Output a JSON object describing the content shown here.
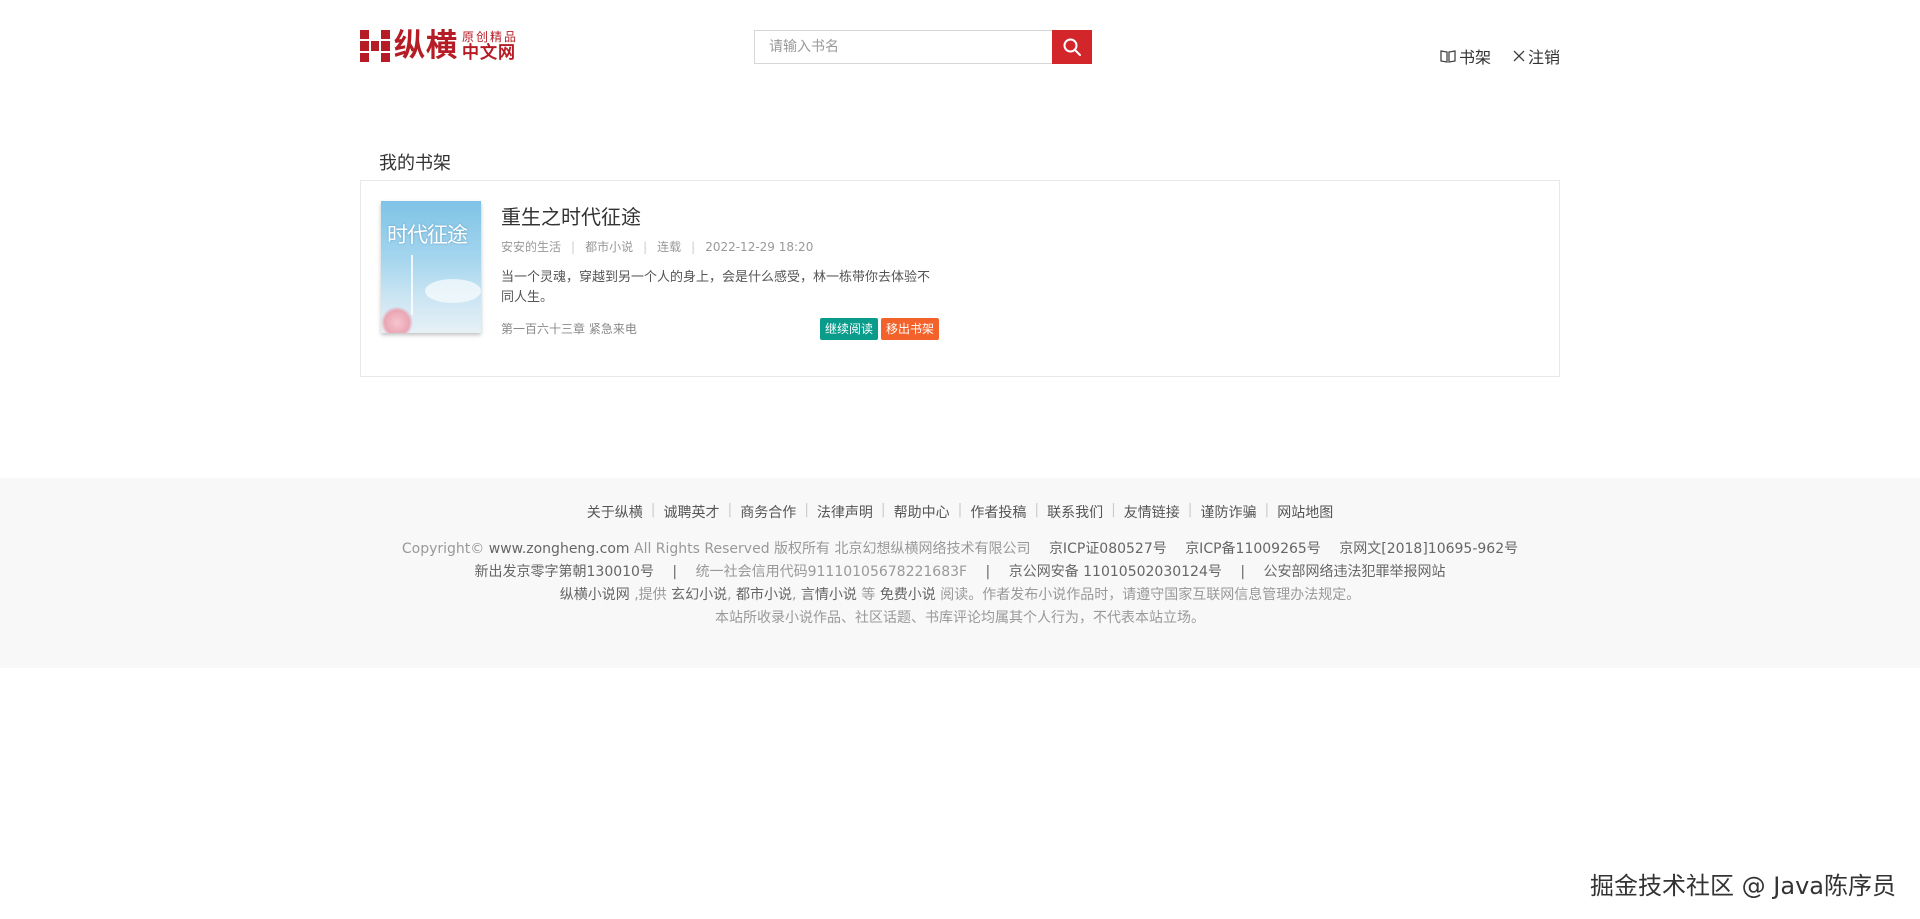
{
  "header": {
    "logo": {
      "main": "纵横",
      "sub_top": "原创精品",
      "sub_bottom": "中文网"
    },
    "search": {
      "placeholder": "请输入书名"
    },
    "links": {
      "bookshelf": "书架",
      "logout": "注销"
    }
  },
  "shelf": {
    "title": "我的书架",
    "book": {
      "cover_text": "时代征途",
      "name": "重生之时代征途",
      "author": "安安的生活",
      "category": "都市小说",
      "status": "连载",
      "updated": "2022-12-29 18:20",
      "description": "当一个灵魂，穿越到另一个人的身上，会是什么感受，林一栋带你去体验不同人生。",
      "latest_chapter": "第一百六十三章 紧急来电",
      "continue_label": "继续阅读",
      "remove_label": "移出书架"
    }
  },
  "footer": {
    "nav": [
      "关于纵横",
      "诚聘英才",
      "商务合作",
      "法律声明",
      "帮助中心",
      "作者投稿",
      "联系我们",
      "友情链接",
      "谨防诈骗",
      "网站地图"
    ],
    "copyright_prefix": "Copyright©",
    "site_domain": "www.zongheng.com",
    "rights": "All Rights Reserved 版权所有 北京幻想纵横网络技术有限公司",
    "icp1": "京ICP证080527号",
    "icp2": "京ICP备11009265号",
    "icp3": "京网文[2018]10695-962号",
    "publish": "新出发京零字第朝130010号",
    "credit_code": "统一社会信用代码91110105678221683F",
    "police": "京公网安备 11010502030124号",
    "report": "公安部网络违法犯罪举报网站",
    "line3_site": "纵横小说网",
    "line3_provide": ",提供",
    "line3_g1": "玄幻小说",
    "line3_g2": "都市小说",
    "line3_g3": "言情小说",
    "line3_etc": "等",
    "line3_g4": "免费小说",
    "line3_tail": "阅读。作者发布小说作品时，请遵守国家互联网信息管理办法规定。",
    "disclaimer": "本站所收录小说作品、社区话题、书库评论均属其个人行为，不代表本站立场。"
  },
  "watermark": "掘金技术社区 @ Java陈序员",
  "colors": {
    "brand": "#b51c25",
    "search_button": "#d3262b",
    "continue": "#0a9c8b",
    "remove": "#f4622b"
  }
}
